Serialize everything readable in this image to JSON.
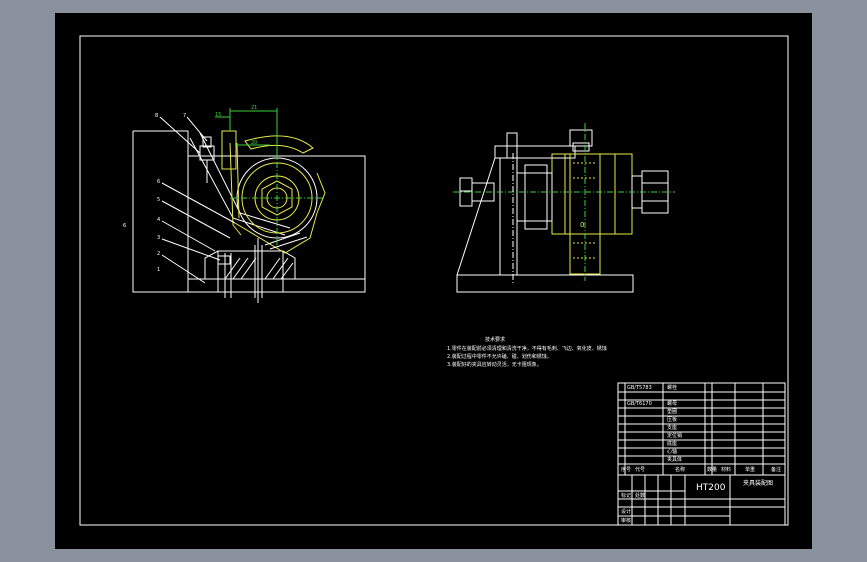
{
  "sheet": {
    "background": "#000000",
    "outer_background": "#8a929e"
  },
  "colors": {
    "outline": "#ffffff",
    "part": "#e8e84a",
    "dimension": "#3bd13b"
  },
  "front_view": {
    "balloons": [
      "8",
      "7",
      "6",
      "5",
      "4",
      "3",
      "2",
      "1"
    ],
    "dim_top": "21",
    "dim_small": [
      "15",
      "20"
    ],
    "left_mark": "6"
  },
  "side_view": {
    "center_mark": "0"
  },
  "notes": {
    "title": "技术要求",
    "lines": [
      "1.零件在装配前必须清理和清洗干净，不得有毛刺、飞边、氧化皮、锈蚀",
      "2.装配过程中零件不允许磕、碰、划伤和锈蚀，",
      "3.装配好的夹具应转动灵活，无卡阻现象。"
    ]
  },
  "title_block": {
    "material": "HT200",
    "drawing_name": "夹具装配图"
  }
}
